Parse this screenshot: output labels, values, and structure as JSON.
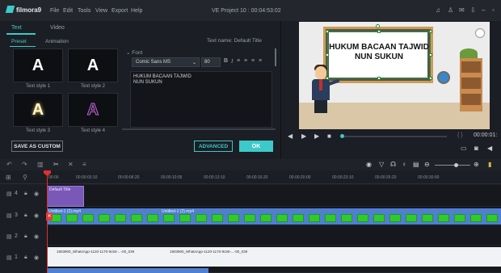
{
  "app": {
    "logo": "filmora9",
    "window_title": "VE Project 10 : 00:04:53:02"
  },
  "menu": [
    "File",
    "Edit",
    "Tools",
    "View",
    "Export",
    "Help"
  ],
  "window_controls": [
    "headphone-icon",
    "user-icon",
    "mail-icon",
    "download-icon",
    "minimize-icon",
    "maximize-icon"
  ],
  "tabs": [
    {
      "label": "Text",
      "active": true
    },
    {
      "label": "Video",
      "active": false
    }
  ],
  "subtabs": [
    {
      "label": "Preset",
      "active": true
    },
    {
      "label": "Animation",
      "active": false
    }
  ],
  "text_styles": [
    {
      "glyph": "A",
      "label": "Text style 1"
    },
    {
      "glyph": "A",
      "label": "Text style 2"
    },
    {
      "glyph": "A",
      "label": "Text style 3"
    },
    {
      "glyph": "A",
      "label": "Text style 4"
    }
  ],
  "text_panel": {
    "text_name": "Text name: Default Title",
    "font_section": "Font",
    "font_family": "Comic Sans MS",
    "font_size": "80",
    "bold": "B",
    "italic": "I",
    "content": "HUKUM BACAAN TAJWID\nNUN SUKUN"
  },
  "buttons": {
    "save_custom": "SAVE AS CUSTOM",
    "advanced": "ADVANCED",
    "ok": "OK"
  },
  "preview": {
    "title_line1": "HUKUM BACAAN TAJWID",
    "title_line2": "NUN SUKUN",
    "timecode": "00:00:01:",
    "progress": 0.0
  },
  "ruler_labels": [
    "00:00",
    "00:00:03:10",
    "00:00:06:20",
    "00:00:10:05",
    "00:00:13:10",
    "00:00:16:20",
    "00:00:20:00",
    "00:00:23:10",
    "00:00:26:20",
    "00:00:30:00"
  ],
  "tracks": [
    {
      "id": "4"
    },
    {
      "id": "3"
    },
    {
      "id": "2"
    },
    {
      "id": "1"
    }
  ],
  "clips": {
    "title_clip": "Default Title",
    "video_clip_1": "Untitled-1 (2).mp4",
    "video_clip_2": "Untitled-1 (2).mp4",
    "audio_clip_1": "1903900_WhatsApp-1120-1170-9c50-...-00_039",
    "audio_clip_2": "1903900_WhatsApp-1120-1170-9c50-...-00_039"
  },
  "colors": {
    "accent": "#3ec9c9",
    "title_clip": "#7a58b8",
    "video_clip": "#4f7fcf",
    "playhead": "#e03030"
  }
}
